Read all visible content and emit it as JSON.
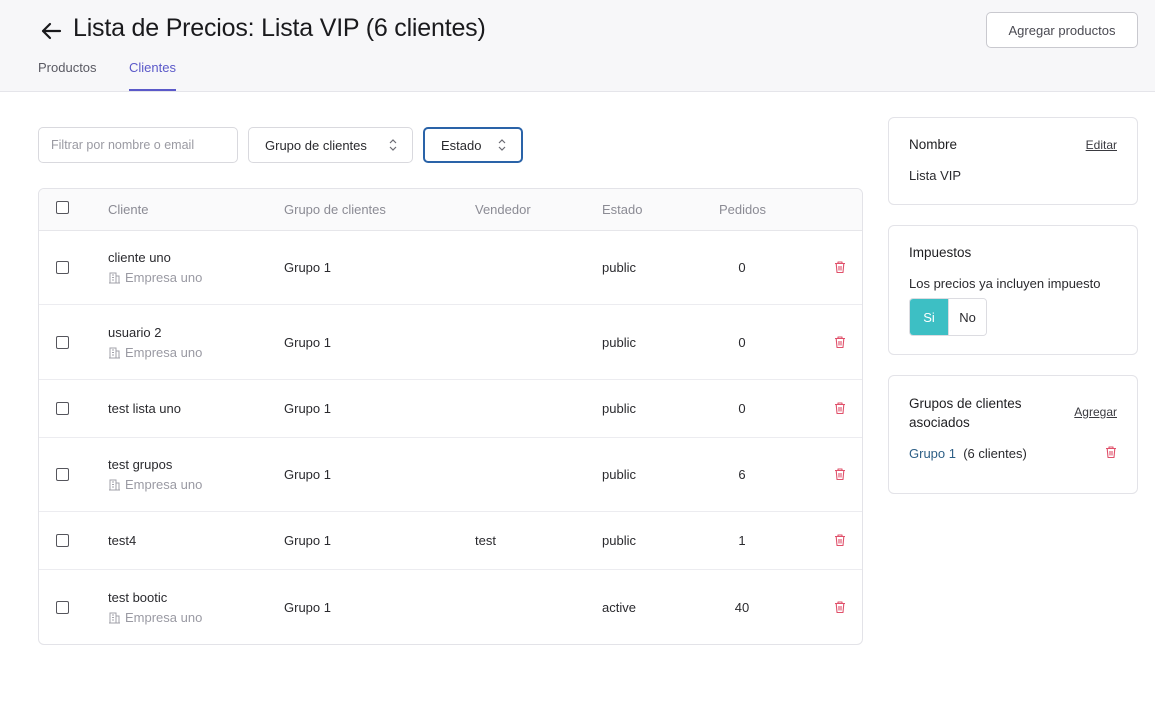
{
  "header": {
    "title": "Lista de Precios: Lista VIP (6 clientes)",
    "add_products_label": "Agregar productos",
    "tabs": [
      {
        "label": "Productos",
        "active": false
      },
      {
        "label": "Clientes",
        "active": true
      }
    ]
  },
  "filters": {
    "search_placeholder": "Filtrar por nombre o email",
    "search_value": "",
    "group_select_label": "Grupo de clientes",
    "status_select_label": "Estado"
  },
  "table": {
    "columns": [
      "Cliente",
      "Grupo de clientes",
      "Vendedor",
      "Estado",
      "Pedidos"
    ],
    "rows": [
      {
        "cliente": "cliente uno",
        "empresa": "Empresa uno",
        "grupo": "Grupo 1",
        "vendedor": "",
        "estado": "public",
        "pedidos": "0"
      },
      {
        "cliente": "usuario 2",
        "empresa": "Empresa uno",
        "grupo": "Grupo 1",
        "vendedor": "",
        "estado": "public",
        "pedidos": "0"
      },
      {
        "cliente": "test lista uno",
        "empresa": "",
        "grupo": "Grupo 1",
        "vendedor": "",
        "estado": "public",
        "pedidos": "0"
      },
      {
        "cliente": "test grupos",
        "empresa": "Empresa uno",
        "grupo": "Grupo 1",
        "vendedor": "",
        "estado": "public",
        "pedidos": "6"
      },
      {
        "cliente": "test4",
        "empresa": "",
        "grupo": "Grupo 1",
        "vendedor": "test",
        "estado": "public",
        "pedidos": "1"
      },
      {
        "cliente": "test bootic",
        "empresa": "Empresa uno",
        "grupo": "Grupo 1",
        "vendedor": "",
        "estado": "active",
        "pedidos": "40"
      }
    ]
  },
  "sidebar": {
    "name_card": {
      "title": "Nombre",
      "edit_label": "Editar",
      "value": "Lista VIP"
    },
    "tax_card": {
      "title": "Impuestos",
      "text": "Los precios ya incluyen impuesto",
      "yes_label": "Si",
      "no_label": "No",
      "selected": "Si"
    },
    "groups_card": {
      "title_line1": "Grupos de clientes",
      "title_line2": "asociados",
      "add_label": "Agregar",
      "group_name": "Grupo 1",
      "group_count": "(6 clientes)"
    }
  },
  "colors": {
    "accent": "#5b59c9",
    "toggle_on": "#3dbfc4",
    "delete": "#e0506a",
    "focus": "#2a63a8",
    "group_link": "#2d5f86"
  }
}
